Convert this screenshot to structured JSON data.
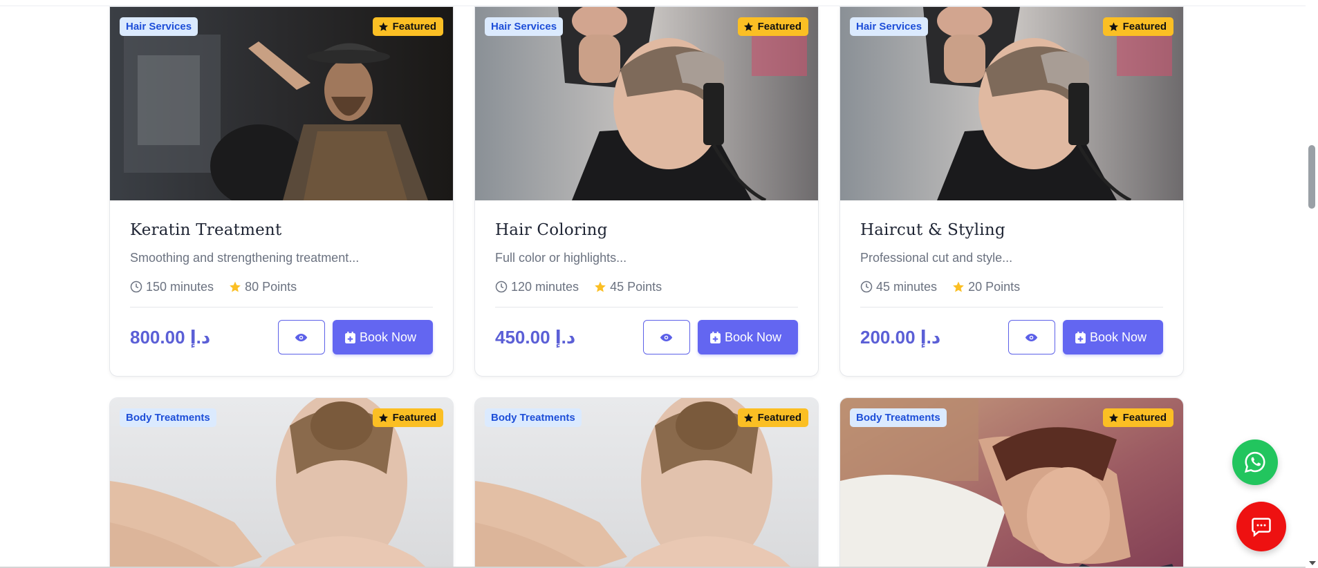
{
  "colors": {
    "accent": "#6366f1",
    "price": "#5b5fd6",
    "featured": "#fbbf24",
    "category_bg": "#dbeafe",
    "category_text": "#1d4ed8",
    "whatsapp": "#22c55e",
    "chat": "#ee1111"
  },
  "services": [
    {
      "category": "Hair Services",
      "featured": "Featured",
      "title": "Keratin Treatment",
      "description": "Smoothing and strengthening treatment...",
      "duration": "150 minutes",
      "points": "80 Points",
      "price": "800.00 د.إ",
      "book_label": "Book Now",
      "image": "barber-scissors-photo"
    },
    {
      "category": "Hair Services",
      "featured": "Featured",
      "title": "Hair Coloring",
      "description": "Full color or highlights...",
      "duration": "120 minutes",
      "points": "45 Points",
      "price": "450.00 د.إ",
      "book_label": "Book Now",
      "image": "barber-comb-photo"
    },
    {
      "category": "Hair Services",
      "featured": "Featured",
      "title": "Haircut & Styling",
      "description": "Professional cut and style...",
      "duration": "45 minutes",
      "points": "20 Points",
      "price": "200.00 د.إ",
      "book_label": "Book Now",
      "image": "barber-comb-photo"
    },
    {
      "category": "Body Treatments",
      "featured": "Featured",
      "image": "neck-massage-photo"
    },
    {
      "category": "Body Treatments",
      "featured": "Featured",
      "image": "neck-massage-photo"
    },
    {
      "category": "Body Treatments",
      "featured": "Featured",
      "image": "relaxing-woman-photo"
    }
  ],
  "floating": {
    "whatsapp_icon": "whatsapp-icon",
    "chat_icon": "chat-bubble-icon"
  }
}
